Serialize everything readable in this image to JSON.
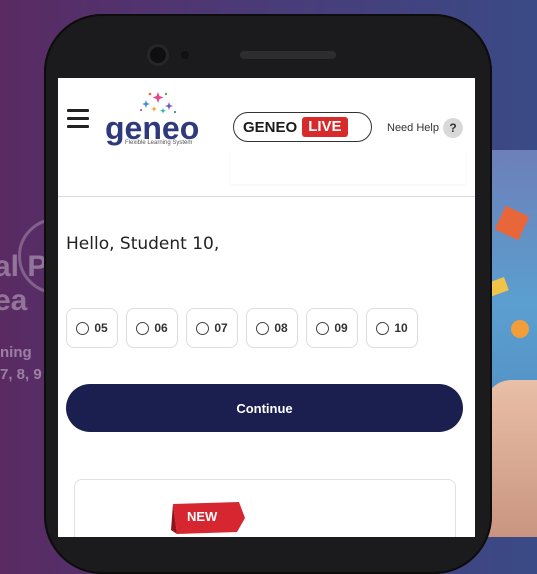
{
  "background": {
    "left_text_lines": [
      "al P",
      "ea"
    ],
    "left_small_lines": [
      "ning",
      "7, 8, 9"
    ]
  },
  "header": {
    "menu_icon": "hamburger-icon",
    "logo": {
      "word": "geneo",
      "tagline": "Flexible Learning System"
    },
    "live_badge": {
      "prefix": "GENEO",
      "live": "LIVE"
    },
    "help": {
      "label": "Need Help",
      "icon_text": "?"
    }
  },
  "main": {
    "greeting": "Hello, Student 10,",
    "grades": [
      {
        "label": "05"
      },
      {
        "label": "06"
      },
      {
        "label": "07"
      },
      {
        "label": "08"
      },
      {
        "label": "09"
      },
      {
        "label": "10"
      }
    ],
    "continue_label": "Continue",
    "card": {
      "ribbon_label": "NEW"
    }
  },
  "colors": {
    "brand_navy": "#1b1f4f",
    "live_red": "#d72a2a",
    "logo_blue": "#2f3a7c"
  }
}
